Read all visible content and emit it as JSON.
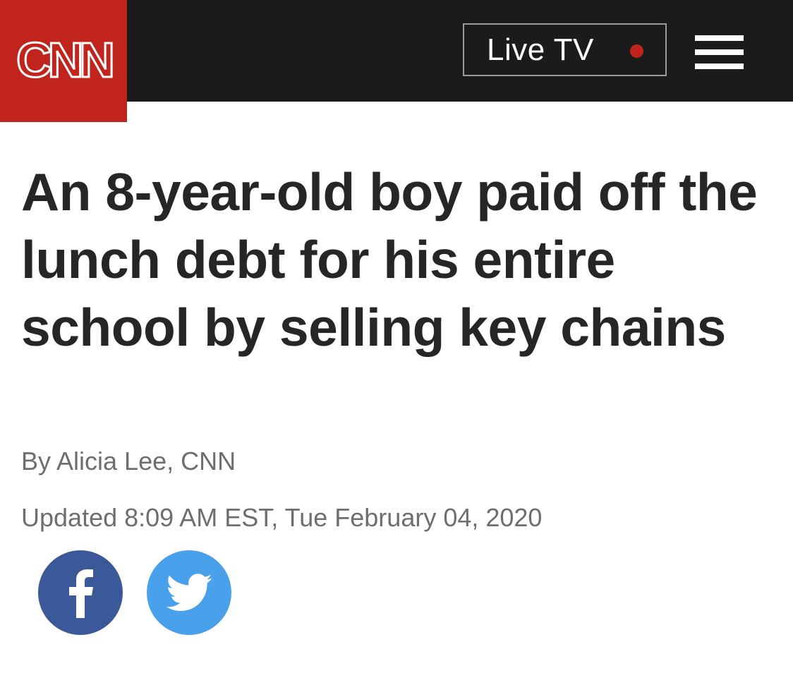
{
  "header": {
    "logo_text": "CNN",
    "live_tv_label": "Live TV",
    "menu_icon": "hamburger-menu-icon",
    "colors": {
      "brand_red": "#c1241c",
      "header_bg": "#1b1b1b",
      "live_indicator": "#c1241c"
    }
  },
  "article": {
    "headline": "An 8-year-old boy paid off the lunch debt for his entire school by selling key chains",
    "byline": "By Alicia Lee, CNN",
    "updated": "Updated 8:09 AM EST, Tue February 04, 2020"
  },
  "share": {
    "items": [
      {
        "icon": "facebook-icon",
        "color": "#3b5998"
      },
      {
        "icon": "twitter-icon",
        "color": "#4aa1eb"
      }
    ]
  }
}
